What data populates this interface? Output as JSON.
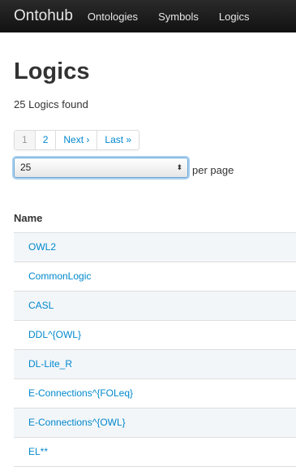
{
  "navbar": {
    "brand": "Ontohub",
    "links": [
      "Ontologies",
      "Symbols",
      "Logics"
    ]
  },
  "page": {
    "title": "Logics",
    "count_text": "25 Logics found"
  },
  "pagination": {
    "items": [
      "1",
      "2",
      "Next ›",
      "Last »"
    ],
    "active_index": 0
  },
  "per_page": {
    "selected": "25",
    "arrows": "⬍",
    "label": "per page"
  },
  "table": {
    "header": "Name",
    "rows": [
      "OWL2",
      "CommonLogic",
      "CASL",
      "DDL^{OWL}",
      "DL-Lite_R",
      "E-Connections^{FOLeq}",
      "E-Connections^{OWL}",
      "EL**"
    ]
  },
  "colors": {
    "link": "#0088cc",
    "navbar": "#1b1b1b",
    "stripe": "#f3f6f9"
  }
}
